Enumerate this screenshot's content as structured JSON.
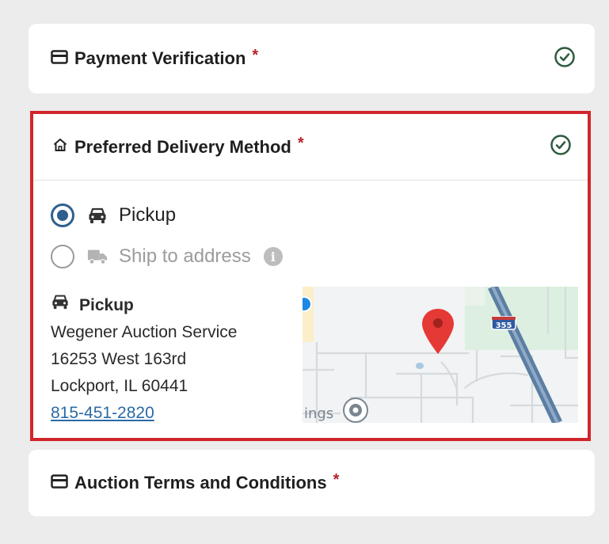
{
  "payment": {
    "title": "Payment Verification",
    "required_mark": "*"
  },
  "delivery": {
    "title": "Preferred Delivery Method",
    "required_mark": "*",
    "options": [
      {
        "label": "Pickup",
        "selected": true,
        "icon": "car-icon"
      },
      {
        "label": "Ship to address",
        "selected": false,
        "disabled": true,
        "icon": "truck-icon"
      }
    ],
    "info_glyph": "i",
    "pickup": {
      "heading": "Pickup",
      "name": "Wegener Auction Service",
      "street": "16253 West 163rd",
      "city": "Lockport, IL 60441",
      "phone": "815-451-2820"
    },
    "map": {
      "fragment_text": "ings",
      "highway_label": "355"
    }
  },
  "terms": {
    "title": "Auction Terms and Conditions",
    "required_mark": "*"
  },
  "colors": {
    "accent": "#2f5f8f",
    "required": "#b5232a",
    "highlight_border": "#d0262b",
    "check": "#2d5b3f",
    "link": "#2b6aa5"
  }
}
